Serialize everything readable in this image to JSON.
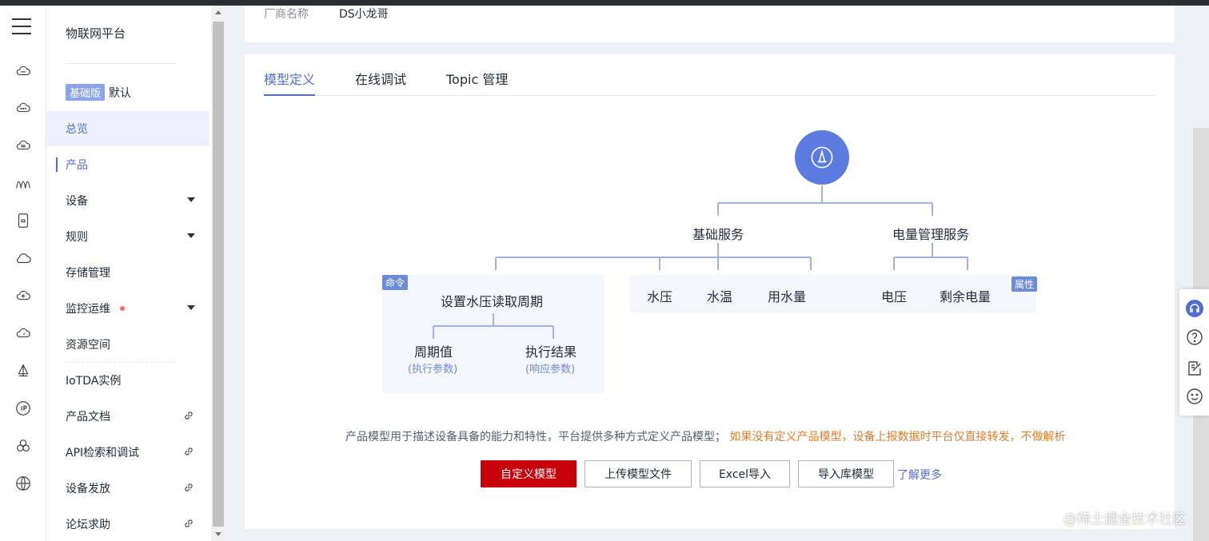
{
  "rail": {
    "icons": [
      "menu-icon",
      "cloud-chat-icon",
      "cloud-dots-icon",
      "cloud-list-icon",
      "signal-icon",
      "phone-icon",
      "cloud-icon",
      "cloud-upload-icon",
      "cloud-gauge-icon",
      "sail-icon",
      "ip-icon",
      "cluster-icon",
      "globe-icon"
    ]
  },
  "sidebar": {
    "title": "物联网平台",
    "edition_badge": "基础版",
    "edition_name": "默认",
    "items": [
      {
        "label": "总览"
      },
      {
        "label": "产品"
      },
      {
        "label": "设备"
      },
      {
        "label": "规则"
      },
      {
        "label": "存储管理"
      },
      {
        "label": "监控运维"
      },
      {
        "label": "资源空间"
      },
      {
        "label": "IoTDA实例"
      },
      {
        "label": "产品文档"
      },
      {
        "label": "API检索和调试"
      },
      {
        "label": "设备发放"
      },
      {
        "label": "论坛求助"
      }
    ]
  },
  "info": {
    "label": "厂商名称",
    "value": "DS小龙哥"
  },
  "tabs": [
    {
      "label": "模型定义"
    },
    {
      "label": "在线调试"
    },
    {
      "label": "Topic 管理"
    }
  ],
  "diagram": {
    "services": [
      "基础服务",
      "电量管理服务"
    ],
    "command_tag": "命令",
    "property_tag": "属性",
    "command": "设置水压读取周期",
    "params": [
      {
        "name": "周期值",
        "note": "(执行参数)"
      },
      {
        "name": "执行结果",
        "note": "(响应参数)"
      }
    ],
    "properties_basic": [
      "水压",
      "水温",
      "用水量"
    ],
    "properties_power": [
      "电压",
      "剩余电量"
    ]
  },
  "description": {
    "normal": "产品模型用于描述设备具备的能力和特性，平台提供多种方式定义产品模型；",
    "warning": "如果没有定义产品模型，设备上报数据时平台仅直接转发，不做解析"
  },
  "buttons": {
    "custom": "自定义模型",
    "upload": "上传模型文件",
    "excel": "Excel导入",
    "library": "导入库模型",
    "learn_more": "了解更多"
  },
  "watermark": "@稀土掘金技术社区",
  "colors": {
    "accent": "#526ecc",
    "primary_button": "#c7000b",
    "warning_text": "#e37d29",
    "node_blue": "#5b7be0"
  }
}
